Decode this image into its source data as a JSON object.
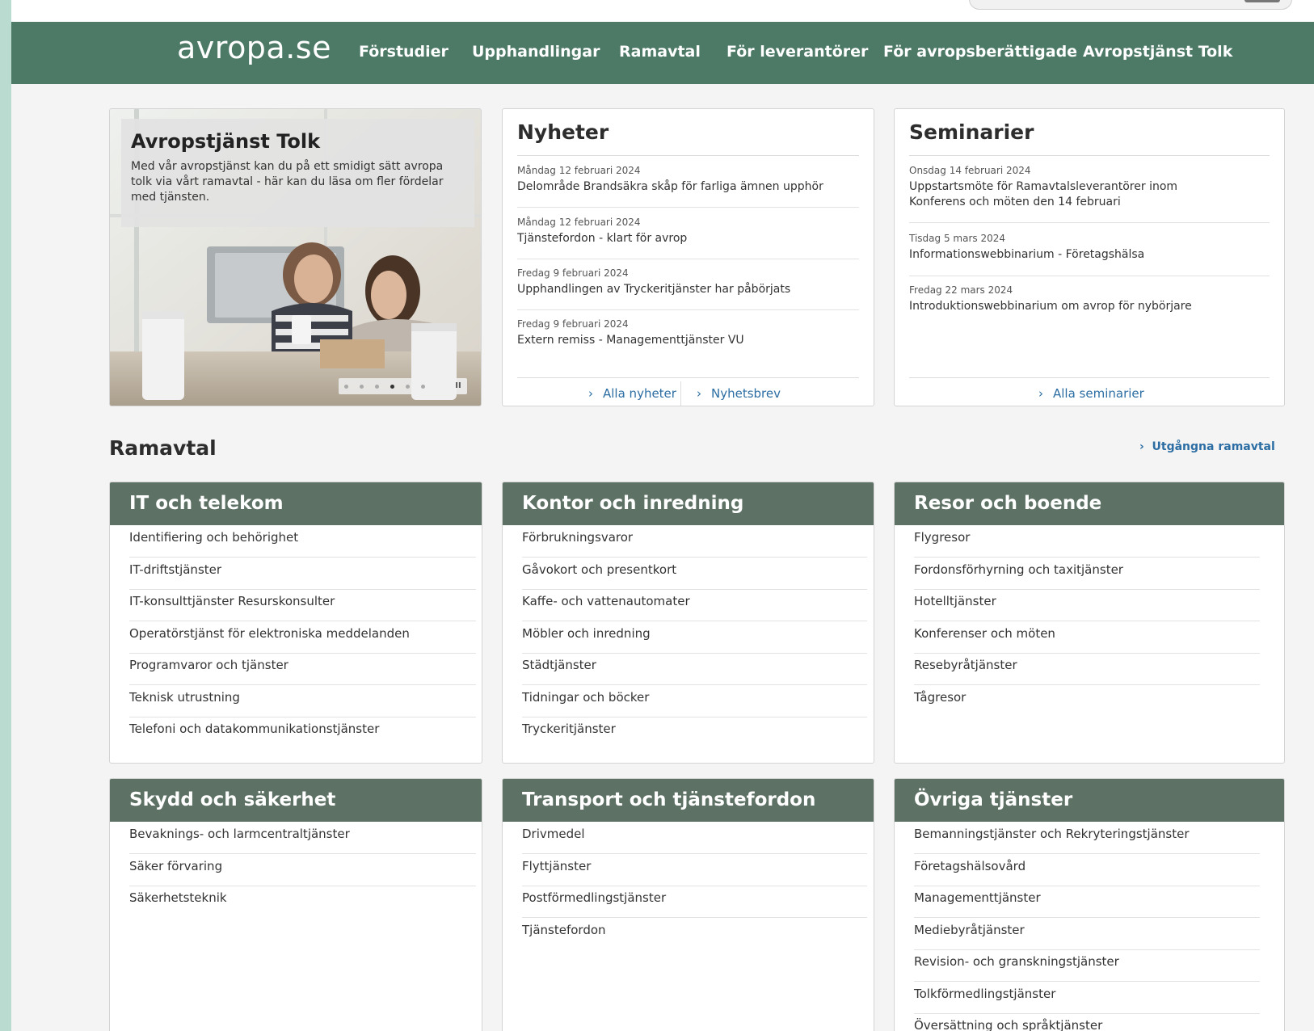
{
  "header": {
    "logo": "avropa.se",
    "nav": [
      "Förstudier",
      "Upphandlingar",
      "Ramavtal",
      "För leverantörer",
      "För avropsberättigade",
      "Avropstjänst Tolk"
    ]
  },
  "hero": {
    "title": "Avropstjänst Tolk",
    "text": "Med vår avropstjänst kan du på ett smidigt sätt avropa tolk via vårt ramavtal - här kan du läsa om fler fördelar med tjänsten.",
    "slide_count": 6,
    "active_slide": 4,
    "pause_symbol": "II"
  },
  "news": {
    "title": "Nyheter",
    "items": [
      {
        "date": "Måndag 12 februari 2024",
        "title": "Delområde Brandsäkra skåp för farliga ämnen upphör"
      },
      {
        "date": "Måndag 12 februari 2024",
        "title": "Tjänstefordon - klart för avrop"
      },
      {
        "date": "Fredag 9 februari 2024",
        "title": "Upphandlingen av Tryckeritjänster har påbörjats"
      },
      {
        "date": "Fredag 9 februari 2024",
        "title": "Extern remiss - Managementtjänster VU"
      }
    ],
    "all_link": "Alla nyheter",
    "newsletter_link": "Nyhetsbrev"
  },
  "seminars": {
    "title": "Seminarier",
    "items": [
      {
        "date": "Onsdag 14 februari 2024",
        "title": "Uppstartsmöte för Ramavtalsleverantörer inom Konferens och möten den 14 februari"
      },
      {
        "date": "Tisdag 5 mars 2024",
        "title": "Informationswebbinarium - Företagshälsa"
      },
      {
        "date": "Fredag 22 mars 2024",
        "title": "Introduktionswebbinarium om avrop för nybörjare"
      }
    ],
    "all_link": "Alla seminarier"
  },
  "ramavtal": {
    "title": "Ramavtal",
    "expired_link": "Utgångna ramavtal",
    "categories": [
      {
        "title": "IT och telekom",
        "items": [
          "Identifiering och behörighet",
          "IT-driftstjänster",
          "IT-konsulttjänster Resurskonsulter",
          "Operatörstjänst för elektroniska meddelanden",
          "Programvaror och tjänster",
          "Teknisk utrustning",
          "Telefoni och datakommunikationstjänster"
        ]
      },
      {
        "title": "Kontor och inredning",
        "items": [
          "Förbrukningsvaror",
          "Gåvokort och presentkort",
          "Kaffe- och vattenautomater",
          "Möbler och inredning",
          "Städtjänster",
          "Tidningar och böcker",
          "Tryckeritjänster"
        ]
      },
      {
        "title": "Resor och boende",
        "items": [
          "Flygresor",
          "Fordonsförhyrning och taxitjänster",
          "Hotelltjänster",
          "Konferenser och möten",
          "Resebyråtjänster",
          "Tågresor"
        ]
      },
      {
        "title": "Skydd och säkerhet",
        "items": [
          "Bevaknings- och larmcentraltjänster",
          "Säker förvaring",
          "Säkerhetsteknik"
        ]
      },
      {
        "title": "Transport och tjänstefordon",
        "items": [
          "Drivmedel",
          "Flyttjänster",
          "Postförmedlingstjänster",
          "Tjänstefordon"
        ]
      },
      {
        "title": "Övriga tjänster",
        "items": [
          "Bemanningstjänster och Rekryteringstjänster",
          "Företagshälsovård",
          "Managementtjänster",
          "Mediebyråtjänster",
          "Revision- och granskningstjänster",
          "Tolkförmedlingstjänster",
          "Översättning och språktjänster"
        ]
      }
    ]
  }
}
